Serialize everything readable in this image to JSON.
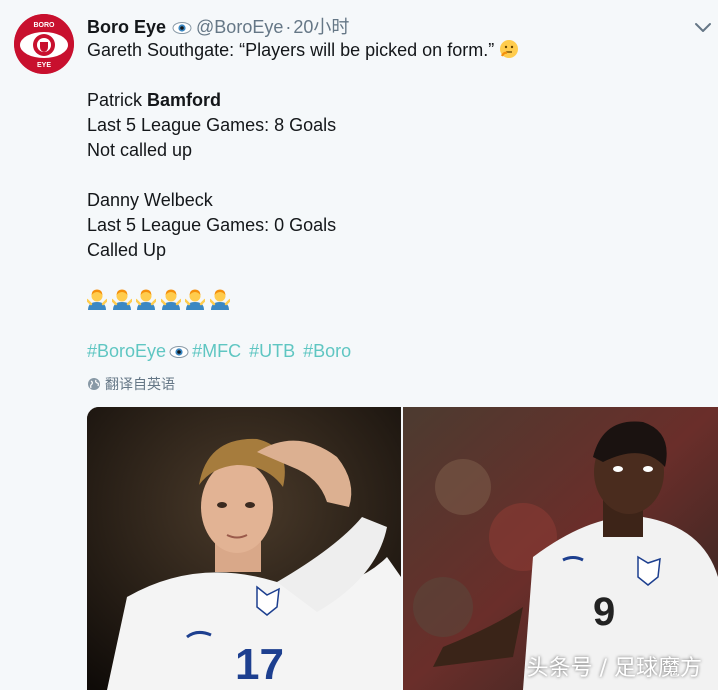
{
  "tweet": {
    "author_name": "Boro Eye",
    "author_handle": "@BoroEye",
    "timestamp": "20小时",
    "avatar_text_top": "BORO",
    "avatar_text_bottom": "EYE",
    "lines": {
      "quote": "Gareth Southgate: “Players will be picked on form.” ",
      "p1_first": "Patrick ",
      "p1_last": "Bamford",
      "p1_stat": "Last 5 League Games: 8 Goals",
      "p1_status": "Not called up",
      "p2_name": "Danny Welbeck",
      "p2_stat": "Last 5 League Games: 0 Goals",
      "p2_status": "Called Up"
    },
    "hashtags": [
      "#BoroEye",
      "#MFC",
      "#UTB",
      "#Boro"
    ],
    "translate_label": "翻译自英语",
    "photo_numbers": {
      "left": "17",
      "right": "9"
    },
    "watermark": "头条号 / 足球魔方"
  },
  "colors": {
    "hashtag": "#5fc6c2",
    "avatar_red": "#c8102e",
    "muted": "#657786"
  },
  "icons": [
    "eye-icon",
    "thinking-face-icon",
    "person-shrugging-icon",
    "globe-icon",
    "chevron-down-icon"
  ]
}
